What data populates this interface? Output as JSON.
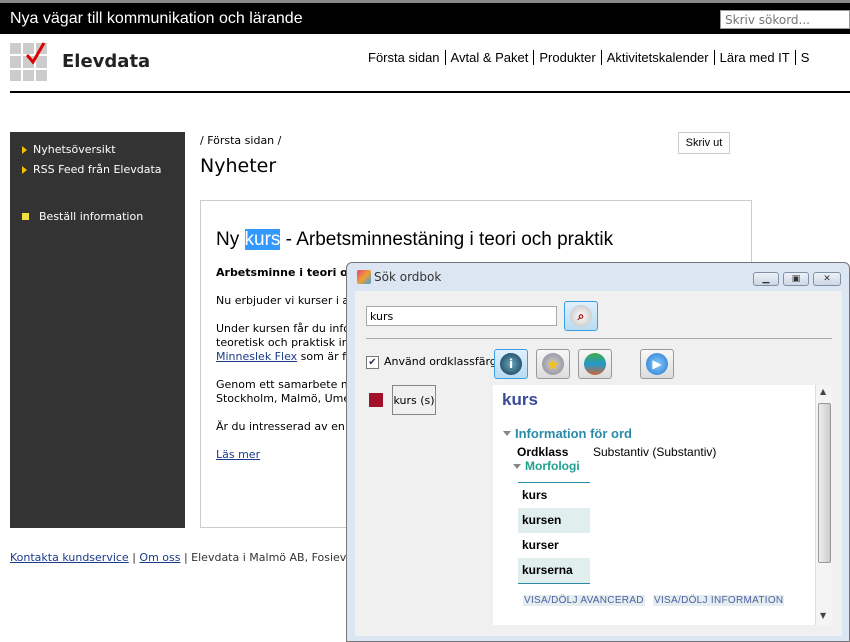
{
  "site": {
    "tagline": "Nya vägar till kommunikation och lärande",
    "search_placeholder": "Skriv sökord...",
    "brand": "Elevdata",
    "nav": [
      "Första sidan",
      "Avtal & Paket",
      "Produkter",
      "Aktivitetskalender",
      "Lära med IT",
      "S"
    ]
  },
  "sidebar": {
    "items": [
      {
        "label": "Nyhetsöversikt"
      },
      {
        "label": "RSS Feed från Elevdata"
      },
      {
        "label": "Beställ information"
      }
    ]
  },
  "main": {
    "breadcrumb": "/ Första sidan /",
    "title": "Nyheter",
    "print_label": "Skriv ut",
    "article": {
      "headline_pre": "Ny ",
      "headline_highlight": "kurs",
      "headline_post": " - Arbetsminnestäning i teori och praktik",
      "subheading": "Arbetsminne i teori och",
      "p1": "Nu erbjuder vi kurser i arbe",
      "p2_l1": "Under kursen får du inform",
      "p2_l2": "teoretisk och praktisk inform",
      "p2_link": "Minneslek Flex",
      "p2_l3": " som är fram",
      "p3_l1": "Genom ett samarbete med",
      "p3_l2": "Stockholm, Malmö, Umeå, G",
      "p4": "Är du intresserad av en ku",
      "read_more": "Läs mer"
    }
  },
  "footer": {
    "contact": "Kontakta kundservice",
    "about": "Om oss",
    "address": "Elevdata i Malmö AB, Fosievägen 1"
  },
  "dialog": {
    "title": "Sök ordbok",
    "search_value": "kurs",
    "checkbox_label": "Använd ordklassfärg",
    "checkbox_checked": true,
    "word_chip": "kurs (s)",
    "word_class_color": "#a01028",
    "entry": {
      "headword": "kurs",
      "info_header": "Information för ord",
      "ordklass_label": "Ordklass",
      "ordklass_value": "Substantiv (Substantiv)",
      "morph_header": "Morfologi",
      "forms": [
        "kurs",
        "kursen",
        "kurser",
        "kurserna"
      ],
      "toggle_advanced": "VISA/DÖLJ AVANCERAD",
      "toggle_info": "VISA/DÖLJ INFORMATION"
    }
  }
}
